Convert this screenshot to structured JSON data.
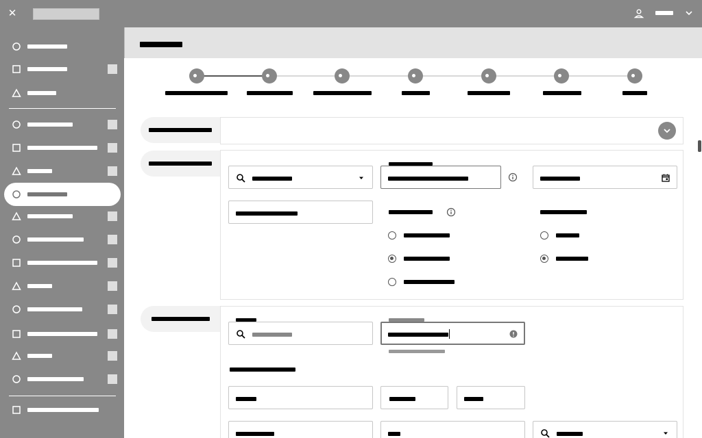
{
  "window": {
    "close_glyph": "✕",
    "title": ""
  },
  "user": {
    "name": "",
    "icon": "user-icon"
  },
  "sidebar": {
    "items": [
      {
        "icon": "circle-icon",
        "label": ""
      },
      {
        "icon": "square-icon",
        "label": ""
      },
      {
        "icon": "triangle-icon",
        "label": ""
      },
      {
        "icon": "circle-icon",
        "label": ""
      },
      {
        "icon": "square-icon",
        "label": ""
      },
      {
        "icon": "triangle-icon",
        "label": ""
      },
      {
        "icon": "circle-icon",
        "label": "",
        "selected": true
      },
      {
        "icon": "triangle-icon",
        "label": ""
      },
      {
        "icon": "circle-icon",
        "label": ""
      },
      {
        "icon": "square-icon",
        "label": ""
      },
      {
        "icon": "triangle-icon",
        "label": ""
      },
      {
        "icon": "circle-icon",
        "label": ""
      },
      {
        "icon": "square-icon",
        "label": ""
      },
      {
        "icon": "triangle-icon",
        "label": ""
      },
      {
        "icon": "circle-icon",
        "label": ""
      },
      {
        "icon": "square-icon",
        "label": ""
      }
    ]
  },
  "page": {
    "title": ""
  },
  "stepper": {
    "steps": [
      "",
      "",
      "",
      "",
      "",
      "",
      ""
    ]
  },
  "sections": [
    {
      "tab": "",
      "collapsed": true
    },
    {
      "tab": ""
    },
    {
      "tab": ""
    }
  ],
  "colors": {
    "sidebar": "#888888",
    "header": "#e3e3e3",
    "panel_border": "#e2e2e2"
  }
}
